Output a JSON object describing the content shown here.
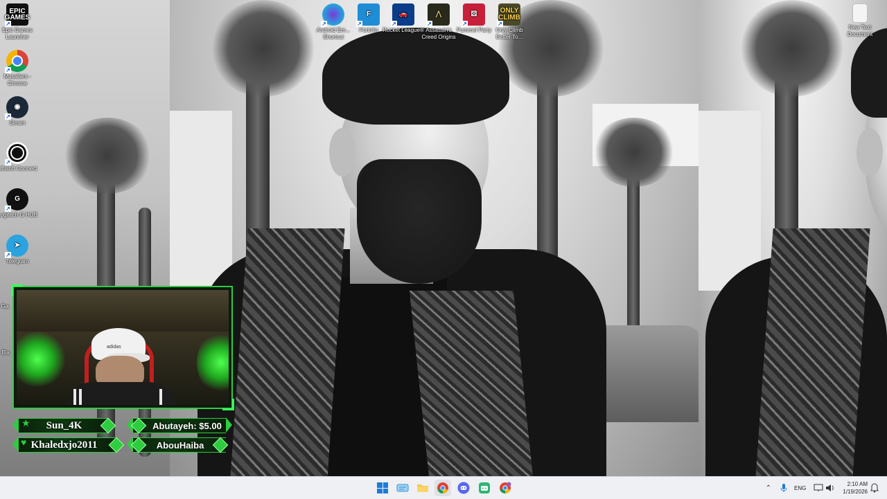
{
  "desktop_icons_left": [
    {
      "name": "epic-games-icon",
      "label": "Epic Games Launcher",
      "glyph": "EPIC GAMES"
    },
    {
      "name": "chrome-profile-icon",
      "label": "Musallam - Chrome",
      "glyph": ""
    },
    {
      "name": "steam-icon",
      "label": "Steam",
      "glyph": "◉"
    },
    {
      "name": "ubisoft-connect-icon",
      "label": "Ubisoft Connect",
      "glyph": ""
    },
    {
      "name": "logitech-g-hub-icon",
      "label": "Logitech G HUB",
      "glyph": "G"
    },
    {
      "name": "telegram-icon",
      "label": "Telegram",
      "glyph": "➤"
    }
  ],
  "desktop_icons_top": [
    {
      "name": "android-emulator-icon",
      "label": "Android Em... Shortcut",
      "glyph": ""
    },
    {
      "name": "fortnite-icon",
      "label": "Fortnite",
      "glyph": "F"
    },
    {
      "name": "rocket-league-icon",
      "label": "Rocket League®",
      "glyph": "🚗"
    },
    {
      "name": "assassins-creed-icon",
      "label": "Assassin's Creed Origins",
      "glyph": "⋀"
    },
    {
      "name": "pummel-party-icon",
      "label": "Pummel Party",
      "glyph": "⚄"
    },
    {
      "name": "only-climb-icon",
      "label": "Only Climb Better To...",
      "glyph": "ONLY CLIMB"
    }
  ],
  "desktop_icon_right": {
    "name": "new-text-document-icon",
    "label": "New Text Document"
  },
  "partial_icons": {
    "ga": "Ga",
    "bla": "Bla"
  },
  "stream_overlay": {
    "follower_latest": "Sun_4K",
    "donation_latest": "Abutayeh: $5.00",
    "sub_latest": "Khaledxjo2011",
    "host_latest": "AbouHaiba",
    "cap_brand": "adidas"
  },
  "taskbar": {
    "language": "ENG",
    "time": "2:10 AM",
    "date": "1/19/2026"
  },
  "colors": {
    "accent_green": "#2ecc40",
    "taskbar_bg": "#eef0f3"
  }
}
